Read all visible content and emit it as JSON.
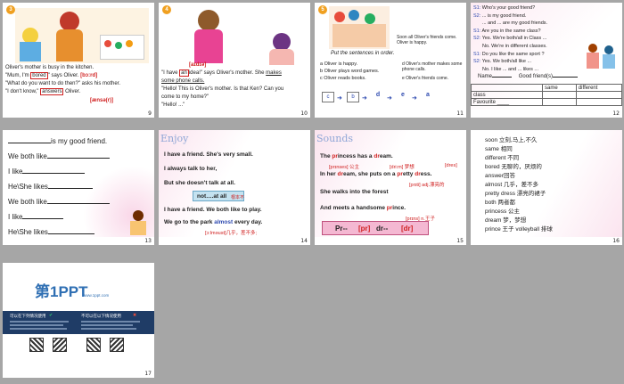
{
  "slides": [
    {
      "number": "9",
      "badge": "3",
      "lines": [
        "Oliver's mother is busy in the kitchen.",
        "\"Mum, I'm",
        "bored",
        "\" says Oliver.",
        "[bɔ:rd]",
        "\"What do you want to do then?\" asks his mother.",
        "\"I don't know,\"",
        "answers",
        "Oliver.",
        "[ænsə(r)]"
      ]
    },
    {
      "number": "10",
      "badge": "4",
      "lines": [
        "[aɪdɪə]",
        "\"I have",
        "an",
        "idea!\" says Oliver's mother. She",
        "makes",
        "some phone calls.",
        "\"Hello! This is Oliver's mother. Is that Ken? Can you",
        "come to my home?\"",
        "\"Hello! ...\""
      ]
    },
    {
      "number": "11",
      "badge": "5",
      "title": "Put the sentences in order.",
      "caption": "Soon all Oliver's friends come. Oliver is happy.",
      "options": [
        "a  Oliver is happy.",
        "b  Oliver plays word games.",
        "c  Oliver reads books.",
        "d  Oliver's mother makes some phone calls.",
        "e  Oliver's friends come."
      ],
      "order": [
        "c",
        "b",
        "d",
        "e",
        "a"
      ]
    },
    {
      "number": "12",
      "dialog": [
        [
          "S1:",
          "Who's your good friend?"
        ],
        [
          "S2:",
          "... is my good friend."
        ],
        [
          "",
          "... and ... are my good friends."
        ],
        [
          "S1:",
          "Are you in the same class?"
        ],
        [
          "S2:",
          "Yes. We're both/all in Class ..."
        ],
        [
          "",
          "No. We're in different classes."
        ],
        [
          "S1:",
          "Do you like the same sport ?"
        ],
        [
          "S2:",
          "Yes. We both/all like ..."
        ],
        [
          "",
          "No. I like ... and ... likes ..."
        ]
      ],
      "table_headers": [
        "Name",
        "Good friend(s)"
      ],
      "table_cols": [
        "same",
        "different"
      ],
      "table_rows": [
        "class",
        "Favourite ____"
      ]
    },
    {
      "number": "13",
      "lines": [
        "is my good friend.",
        "We both like",
        "I like",
        "He\\She likes",
        "We both like",
        "I like",
        "He\\She likes"
      ]
    },
    {
      "number": "14",
      "title": "Enjoy",
      "lines": [
        "I have a friend. She's very small.",
        "I always  talk to her,",
        "But she doesn't talk at all.",
        "not….at all",
        "根本不",
        "I  have a friend. We both like to play.",
        "We go to the park",
        "almost",
        "every day.",
        "[ɔ:lməust]几乎，差不多;"
      ]
    },
    {
      "number": "15",
      "title": "Sounds",
      "lines": [
        "The",
        "pr",
        "incess has a",
        "dr",
        "eam.",
        "[prɪnses]  公主",
        "[dri:m]  梦想",
        "[dres]",
        "In her",
        "dr",
        "eam, she puts on a",
        "pr",
        "etty",
        "dr",
        "ess.",
        "[prɪti] adj.漂亮的",
        "She walks into the forest",
        "And meets a handsome",
        "pr",
        "ince.",
        "[prɪns]  n.王子",
        "Pr--",
        "[pr]",
        "dr--",
        "[dr]"
      ]
    },
    {
      "number": "16",
      "vocab": [
        "soon 立刻,马上,不久",
        "same 相同",
        "different  不同",
        "bored 无聊的，厌烦的",
        "answer回答",
        "almost 几乎，差不多",
        "pretty dress 漂亮的裙子",
        "both 两者都",
        "princess 公主",
        "dream 梦，梦想",
        "prince 王子      volleyball  排球"
      ]
    },
    {
      "number": "17",
      "logo_main": "第1PPT",
      "logo_sub": "www.1ppt.com",
      "left_heading": "可以在下列情况使用",
      "right_heading": "不可以在以下情况使用"
    }
  ]
}
